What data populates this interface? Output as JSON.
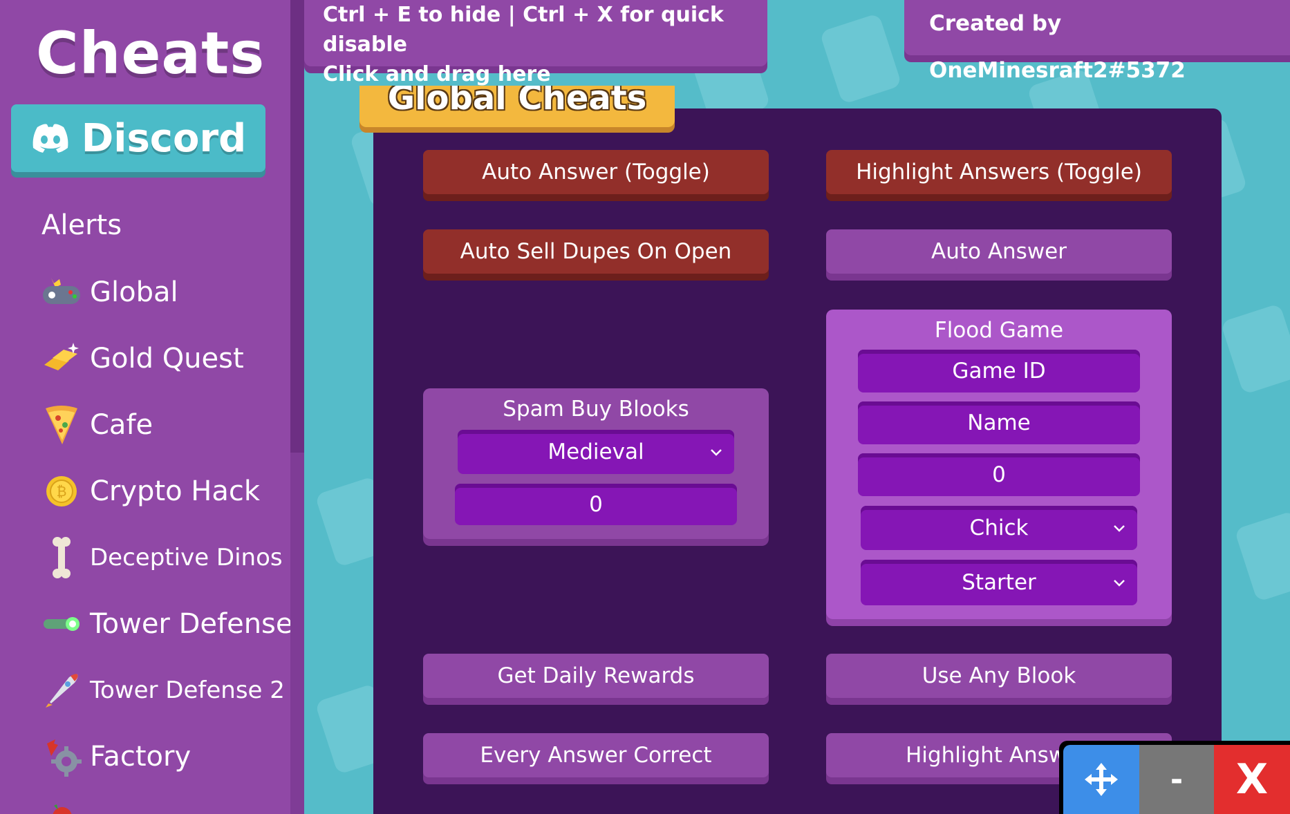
{
  "sidebar": {
    "logo": "Cheats",
    "discord_label": "Discord",
    "items": [
      {
        "label": "Alerts",
        "icon": "none"
      },
      {
        "label": "Global",
        "icon": "gamepad-icon"
      },
      {
        "label": "Gold Quest",
        "icon": "gold-bars-icon"
      },
      {
        "label": "Cafe",
        "icon": "pizza-icon"
      },
      {
        "label": "Crypto Hack",
        "icon": "coin-icon"
      },
      {
        "label": "Deceptive Dinos",
        "icon": "bone-icon"
      },
      {
        "label": "Tower Defense",
        "icon": "laser-icon"
      },
      {
        "label": "Tower Defense 2",
        "icon": "rocket-icon"
      },
      {
        "label": "Factory",
        "icon": "gear-icon"
      }
    ]
  },
  "header": {
    "hint_line1": "Ctrl + E to hide | Ctrl + X for quick disable",
    "hint_line2": "Click and drag here",
    "credit": "Created by OneMinesraft2#5372"
  },
  "panel": {
    "title": "Global Cheats",
    "buttons": {
      "auto_answer_toggle": "Auto Answer (Toggle)",
      "highlight_answers_toggle": "Highlight Answers (Toggle)",
      "auto_sell_dupes": "Auto Sell Dupes On Open",
      "auto_answer": "Auto Answer",
      "get_daily_rewards": "Get Daily Rewards",
      "use_any_blook": "Use Any Blook",
      "every_answer_correct": "Every Answer Correct",
      "highlight_answers": "Highlight Answ"
    },
    "spam_buy": {
      "title": "Spam Buy Blooks",
      "box_selected": "Medieval",
      "amount_value": "0"
    },
    "flood_game": {
      "title": "Flood Game",
      "game_id_placeholder": "Game ID",
      "name_placeholder": "Name",
      "amount_value": "0",
      "blook_selected": "Chick",
      "banner_selected": "Starter"
    }
  },
  "controls": {
    "minimize_label": "-",
    "close_label": "X"
  },
  "colors": {
    "sidebar": "#9048a6",
    "panel": "#3c1457",
    "toggle_off": "#922f2a",
    "title_tab": "#f3b83e",
    "discord": "#4bbbc8",
    "move": "#3d8ee8",
    "minimize": "#777777",
    "close": "#e32e2e"
  }
}
